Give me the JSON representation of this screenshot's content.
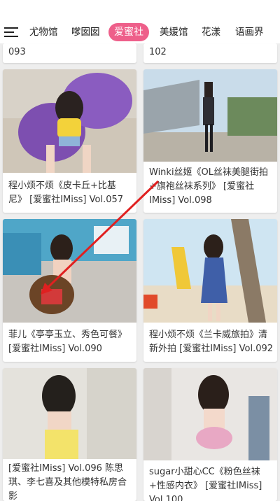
{
  "nav": {
    "tabs": [
      {
        "label": "尤物馆"
      },
      {
        "label": "嗲囡囡"
      },
      {
        "label": "爱蜜社"
      },
      {
        "label": "美媛馆"
      },
      {
        "label": "花漾"
      },
      {
        "label": "语画界"
      }
    ],
    "active_tab": "爱蜜社",
    "accent_color": "#ee5f8a"
  },
  "cards": [
    {
      "caption": "093"
    },
    {
      "caption": "102"
    },
    {
      "caption": "程小烦不烦《皮卡丘+比基尼》 [爱蜜社IMiss] Vol.057"
    },
    {
      "caption": "Winki丝姬《OL丝袜美腿街拍+旗袍丝袜系列》 [爱蜜社IMiss] Vol.098"
    },
    {
      "caption": "菲儿《亭亭玉立、秀色可餐》 [爱蜜社IMiss] Vol.090"
    },
    {
      "caption": "程小烦不烦《兰卡威旅拍》清新外拍 [爱蜜社IMiss] Vol.092"
    },
    {
      "caption": "[爱蜜社IMiss] Vol.096 陈思琪、李七喜及其他模特私房合影"
    },
    {
      "caption": "sugar小甜心CC《粉色丝袜+性感内衣》 [爱蜜社IMiss] Vol.100"
    }
  ],
  "annotation": {
    "arrow_color": "#e02020"
  }
}
